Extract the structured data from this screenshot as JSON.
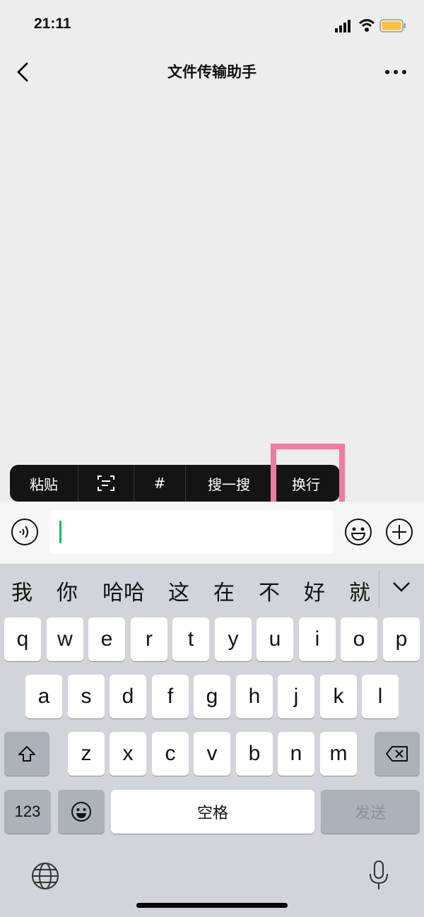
{
  "status_bar": {
    "time": "21:11",
    "icons": [
      "signal-icon",
      "wifi-icon",
      "battery-icon"
    ],
    "battery_color": "#f5c33b"
  },
  "nav": {
    "title": "文件传输助手",
    "left_icon": "back-icon",
    "right_icon": "more-icon"
  },
  "context_menu": {
    "items": [
      {
        "label": "粘贴"
      },
      {
        "label": "",
        "icon": "scan-text-icon"
      },
      {
        "label": "#"
      },
      {
        "label": "搜一搜"
      },
      {
        "label": "换行"
      }
    ],
    "highlight_color": "#f07aa1"
  },
  "input_bar": {
    "value": "",
    "caret_color": "#07c160",
    "icons": [
      "voice-icon",
      "emoji-icon",
      "plus-icon"
    ]
  },
  "keyboard": {
    "candidates": [
      "我",
      "你",
      "哈哈",
      "这",
      "在",
      "不",
      "好",
      "就"
    ],
    "row1": [
      "q",
      "w",
      "e",
      "r",
      "t",
      "y",
      "u",
      "i",
      "o",
      "p"
    ],
    "row2": [
      "a",
      "s",
      "d",
      "f",
      "g",
      "h",
      "j",
      "k",
      "l"
    ],
    "row3": [
      "z",
      "x",
      "c",
      "v",
      "b",
      "n",
      "m"
    ],
    "numbers_label": "123",
    "space_label": "空格",
    "send_label": "发送",
    "icons": [
      "shift-icon",
      "backspace-icon",
      "emoji-key-icon",
      "globe-icon",
      "mic-icon",
      "chevron-down-icon"
    ]
  }
}
